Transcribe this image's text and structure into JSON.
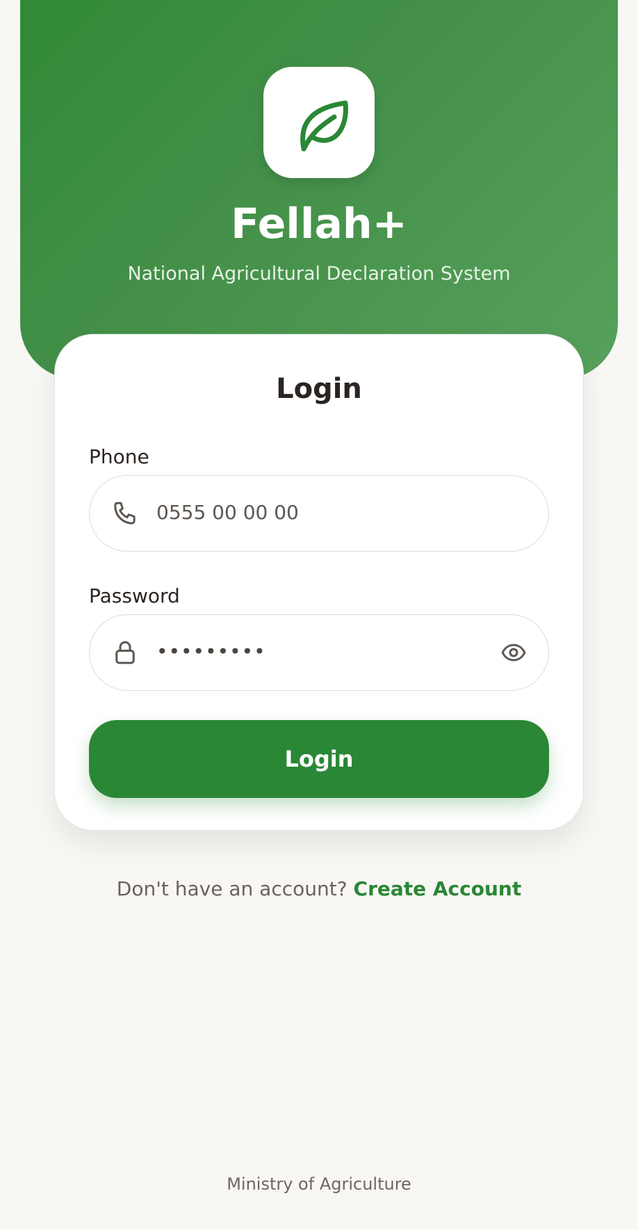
{
  "header": {
    "app_name": "Fellah+",
    "subtitle": "National Agricultural Declaration System",
    "logo_icon": "leaf-icon"
  },
  "login_card": {
    "title": "Login",
    "phone": {
      "label": "Phone",
      "placeholder": "0555 00 00 00",
      "icon": "phone-icon"
    },
    "password": {
      "label": "Password",
      "value": "•••••••••",
      "icon": "lock-icon",
      "toggle_icon": "eye-icon"
    },
    "submit_label": "Login"
  },
  "signup": {
    "prompt": "Don't have an account?",
    "link_label": "Create Account"
  },
  "footer": {
    "text": "Ministry of Agriculture"
  },
  "colors": {
    "primary": "#2a8735",
    "header_gradient_start": "#2f8a36",
    "header_gradient_end": "#56a15b",
    "background": "#f8f7f4",
    "text_dark": "#2b2420",
    "text_muted": "#6a625c"
  }
}
